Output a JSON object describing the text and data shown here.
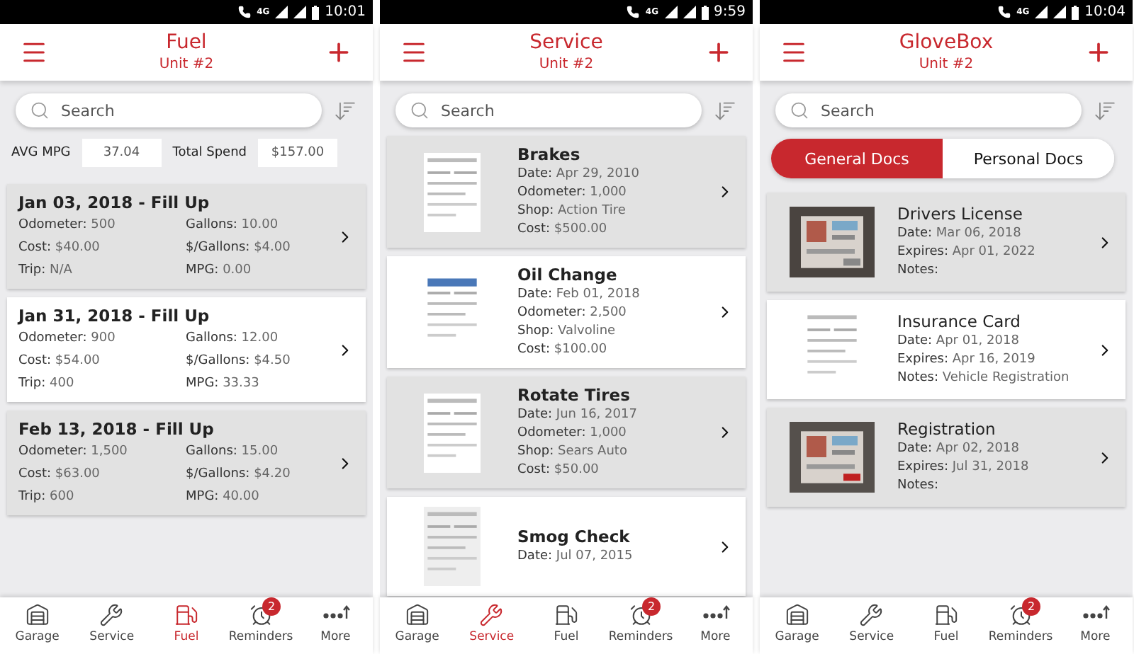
{
  "screens": [
    {
      "kind": "fuel",
      "status": {
        "network": "4G",
        "time": "10:01"
      },
      "title": "Fuel",
      "subtitle": "Unit #2",
      "search": {
        "placeholder": "Search"
      },
      "stats": [
        {
          "label": "AVG MPG",
          "value": "37.04"
        },
        {
          "label": "Total Spend",
          "value": "$157.00"
        }
      ],
      "entries": [
        {
          "title": "Jan 03, 2018 - Fill Up",
          "fields": [
            {
              "label": "Odometer:",
              "value": "500"
            },
            {
              "label": "Gallons:",
              "value": "10.00"
            },
            {
              "label": "Cost:",
              "value": "$40.00"
            },
            {
              "label": "$/Gallons:",
              "value": "$4.00"
            },
            {
              "label": "Trip:",
              "value": "N/A"
            },
            {
              "label": "MPG:",
              "value": "0.00"
            }
          ]
        },
        {
          "title": "Jan 31, 2018 - Fill Up",
          "fields": [
            {
              "label": "Odometer:",
              "value": "900"
            },
            {
              "label": "Gallons:",
              "value": "12.00"
            },
            {
              "label": "Cost:",
              "value": "$54.00"
            },
            {
              "label": "$/Gallons:",
              "value": "$4.50"
            },
            {
              "label": "Trip:",
              "value": "400"
            },
            {
              "label": "MPG:",
              "value": "33.33"
            }
          ]
        },
        {
          "title": "Feb 13, 2018 - Fill Up",
          "fields": [
            {
              "label": "Odometer:",
              "value": "1,500"
            },
            {
              "label": "Gallons:",
              "value": "15.00"
            },
            {
              "label": "Cost:",
              "value": "$63.00"
            },
            {
              "label": "$/Gallons:",
              "value": "$4.20"
            },
            {
              "label": "Trip:",
              "value": "600"
            },
            {
              "label": "MPG:",
              "value": "40.00"
            }
          ]
        }
      ],
      "nav": [
        {
          "kind": "garage",
          "label": "Garage",
          "selected": false
        },
        {
          "kind": "service",
          "label": "Service",
          "selected": false
        },
        {
          "kind": "fuel",
          "label": "Fuel",
          "selected": true
        },
        {
          "kind": "reminders",
          "label": "Reminders",
          "selected": false,
          "badge": "2"
        },
        {
          "kind": "more",
          "label": "More",
          "selected": false
        }
      ]
    },
    {
      "kind": "service",
      "status": {
        "network": "4G",
        "time": "9:59"
      },
      "title": "Service",
      "subtitle": "Unit #2",
      "search": {
        "placeholder": "Search"
      },
      "entries": [
        {
          "title": "Brakes",
          "thumb": {
            "kind": "picture"
          },
          "fields": [
            {
              "label": "Date:",
              "value": "Apr 29, 2010"
            },
            {
              "label": "Odometer:",
              "value": "1,000"
            },
            {
              "label": "Shop:",
              "value": "Action Tire"
            },
            {
              "label": "Cost:",
              "value": "$500.00"
            }
          ]
        },
        {
          "title": "Oil Change",
          "thumb": {
            "kind": "picture"
          },
          "fields": [
            {
              "label": "Date:",
              "value": "Feb 01, 2018"
            },
            {
              "label": "Odometer:",
              "value": "2,500"
            },
            {
              "label": "Shop:",
              "value": "Valvoline"
            },
            {
              "label": "Cost:",
              "value": "$100.00"
            }
          ]
        },
        {
          "title": "Rotate Tires",
          "thumb": {
            "kind": "picture"
          },
          "fields": [
            {
              "label": "Date:",
              "value": "Jun 16, 2017"
            },
            {
              "label": "Odometer:",
              "value": "1,000"
            },
            {
              "label": "Shop:",
              "value": "Sears Auto"
            },
            {
              "label": "Cost:",
              "value": "$50.00"
            }
          ]
        },
        {
          "title": "Smog Check",
          "thumb": {
            "kind": "picture"
          },
          "fields": [
            {
              "label": "Date:",
              "value": "Jul 07, 2015"
            }
          ]
        }
      ],
      "nav": [
        {
          "kind": "garage",
          "label": "Garage",
          "selected": false
        },
        {
          "kind": "service",
          "label": "Service",
          "selected": true
        },
        {
          "kind": "fuel",
          "label": "Fuel",
          "selected": false
        },
        {
          "kind": "reminders",
          "label": "Reminders",
          "selected": false,
          "badge": "2"
        },
        {
          "kind": "more",
          "label": "More",
          "selected": false
        }
      ]
    },
    {
      "kind": "glovebox",
      "status": {
        "network": "4G",
        "time": "10:04"
      },
      "title": "GloveBox",
      "subtitle": "Unit #2",
      "search": {
        "placeholder": "Search"
      },
      "segments": [
        {
          "label": "General Docs",
          "selected": true
        },
        {
          "label": "Personal Docs",
          "selected": false
        }
      ],
      "entries": [
        {
          "title": "Drivers License",
          "thumb": {
            "kind": "picture"
          },
          "fields": [
            {
              "label": "Date:",
              "value": "Mar 06, 2018"
            },
            {
              "label": "Expires:",
              "value": "Apr 01, 2022"
            },
            {
              "label": "Notes:"
            }
          ]
        },
        {
          "title": "Insurance Card",
          "thumb": {
            "kind": "picture"
          },
          "fields": [
            {
              "label": "Date:",
              "value": "Apr 01, 2018"
            },
            {
              "label": "Expires:",
              "value": "Apr 16, 2019"
            },
            {
              "label": "Notes:",
              "value": "Vehicle Registration"
            }
          ]
        },
        {
          "title": "Registration",
          "thumb": {
            "kind": "picture"
          },
          "fields": [
            {
              "label": "Date:",
              "value": "Apr 02, 2018"
            },
            {
              "label": "Expires:",
              "value": "Jul 31, 2018"
            },
            {
              "label": "Notes:"
            }
          ]
        }
      ],
      "nav": [
        {
          "kind": "garage",
          "label": "Garage",
          "selected": false
        },
        {
          "kind": "service",
          "label": "Service",
          "selected": false
        },
        {
          "kind": "fuel",
          "label": "Fuel",
          "selected": false
        },
        {
          "kind": "reminders",
          "label": "Reminders",
          "selected": false,
          "badge": "2"
        },
        {
          "kind": "more",
          "label": "More",
          "selected": false
        }
      ]
    }
  ]
}
